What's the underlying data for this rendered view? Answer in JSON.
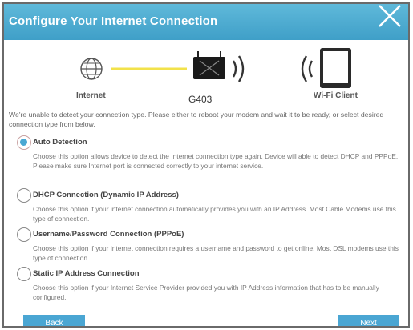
{
  "dialog": {
    "title": "Configure Your Internet Connection"
  },
  "diagram": {
    "internet_label": "Internet",
    "router_label": "G403",
    "client_label": "Wi-Fi Client"
  },
  "intro_text": "We're unable to detect your connection type. Please either to reboot your modem and wait it to be ready, or select desired connection type from below.",
  "options": [
    {
      "label": "Auto Detection",
      "description": "Choose this option allows device to detect the Internet connection type again. Device will able to detect DHCP and PPPoE. Please make sure Internet port is connected correctly to your internet service.",
      "selected": true
    },
    {
      "label": "DHCP Connection (Dynamic IP Address)",
      "description": "Choose this option if your internet connection automatically provides you with an IP Address. Most Cable Modems use this type of connection.",
      "selected": false
    },
    {
      "label": "Username/Password Connection (PPPoE)",
      "description": "Choose this option if your internet connection requires a username and password to get online. Most DSL modems use this type of connection.",
      "selected": false
    },
    {
      "label": "Static IP Address Connection",
      "description": "Choose this option if your Internet Service Provider provided you with IP Address information that has to be manually configured.",
      "selected": false
    }
  ],
  "buttons": {
    "back_label": "Back",
    "next_label": "Next"
  },
  "colors": {
    "title_bar": "#4aa8d3",
    "accent": "#4aa6d3",
    "connector_line": "#f2e24a"
  }
}
